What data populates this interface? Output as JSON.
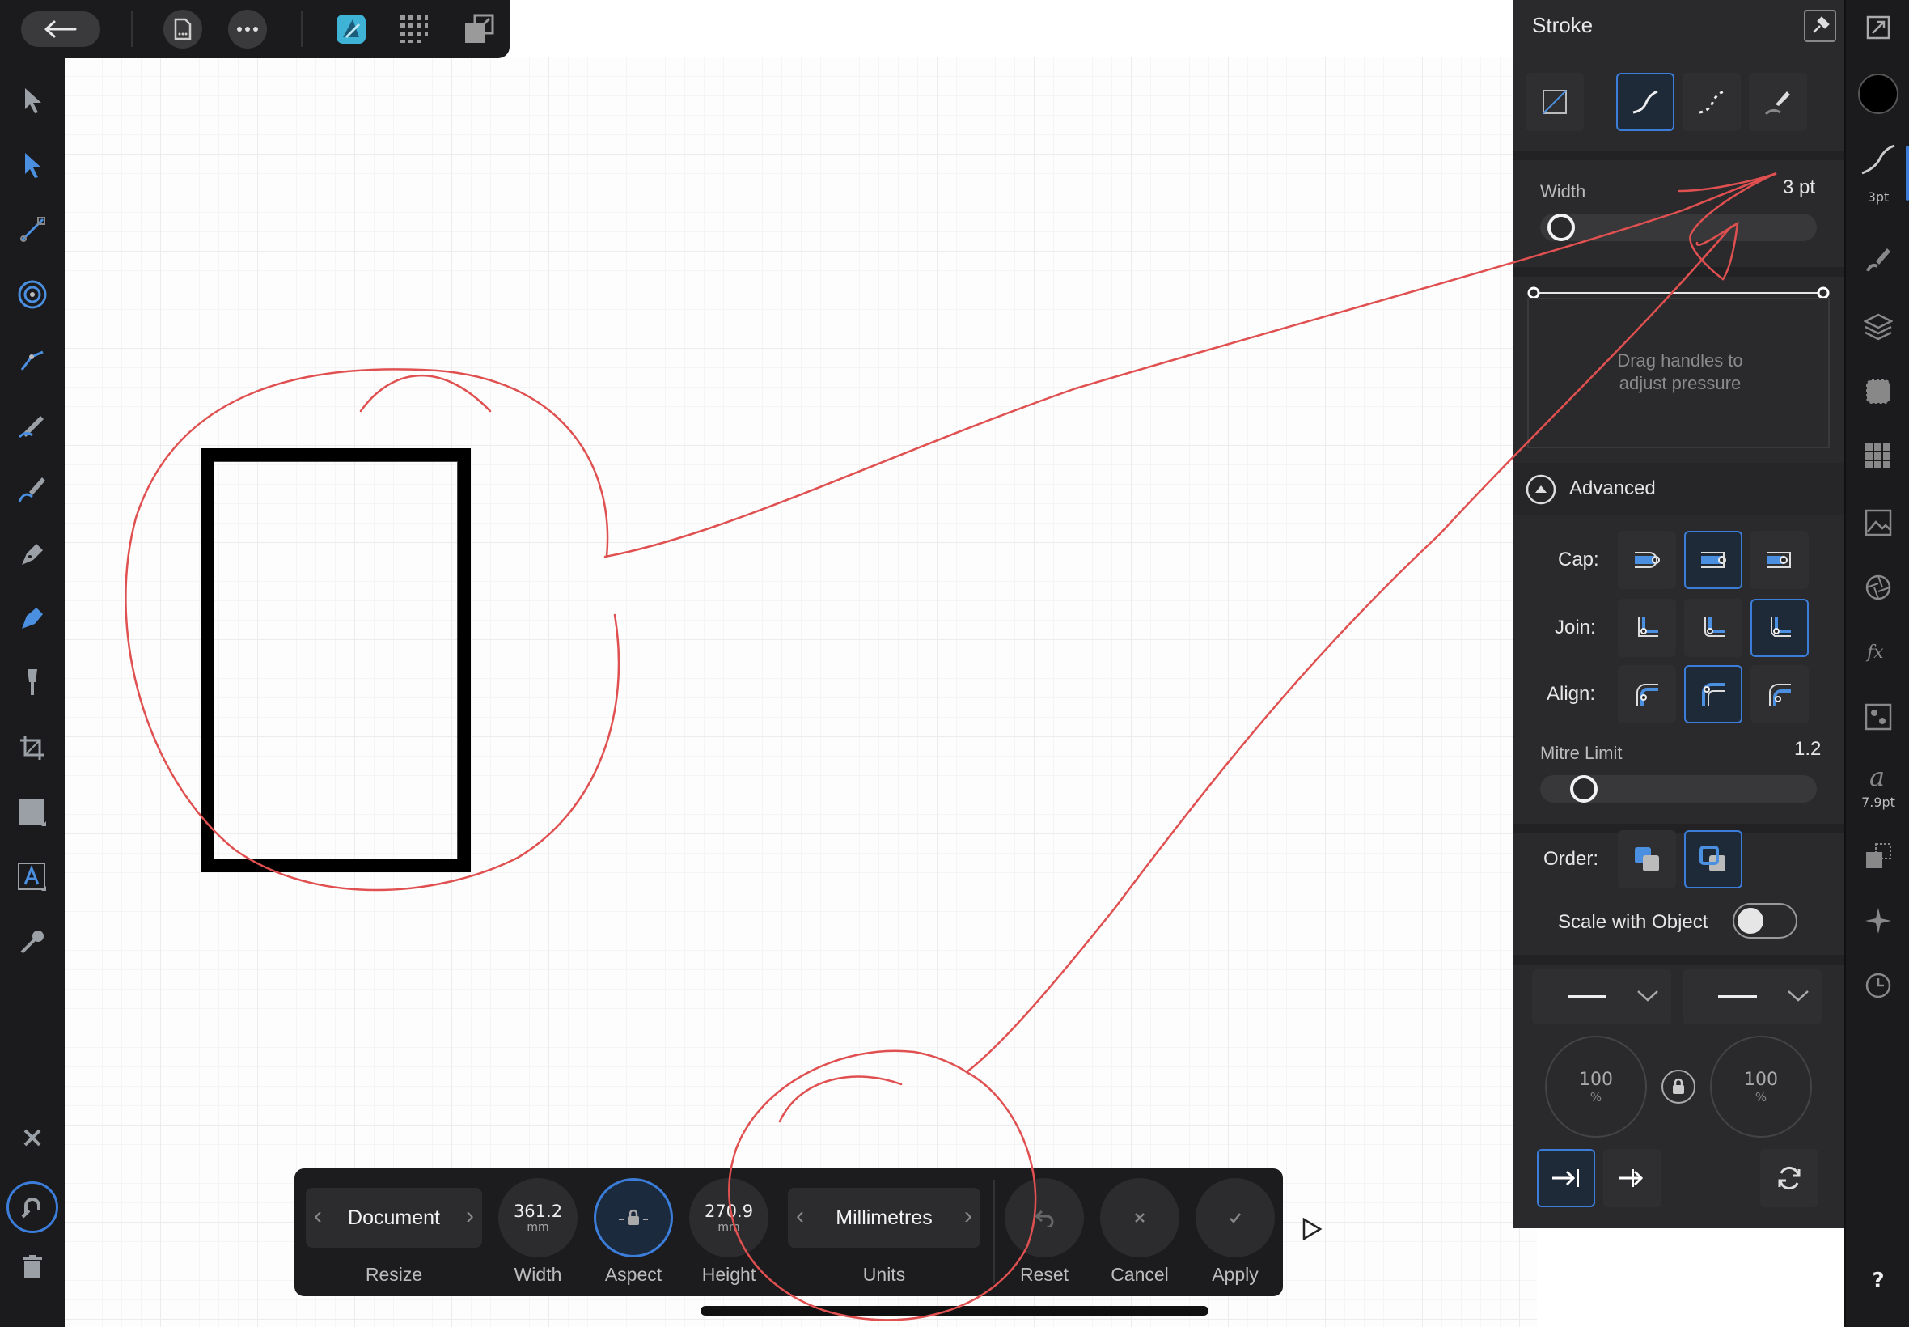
{
  "panel": {
    "title": "Stroke",
    "width_label": "Width",
    "width_value": "3 pt",
    "width_fraction": 0.03,
    "pressure_hint_line1": "Drag handles to",
    "pressure_hint_line2": "adjust pressure",
    "advanced_label": "Advanced",
    "cap_label": "Cap:",
    "join_label": "Join:",
    "align_label": "Align:",
    "mitre_label": "Mitre Limit",
    "mitre_value": "1.2",
    "mitre_fraction": 0.12,
    "order_label": "Order:",
    "scale_label": "Scale with Object",
    "scale_enabled": false,
    "start_scale": "100",
    "end_scale": "100",
    "percent_unit": "%"
  },
  "rightstrip": {
    "brush_size": "3pt",
    "font_size": "7.9pt",
    "help": "?"
  },
  "resizebar": {
    "mode": "Document",
    "mode_label": "Resize",
    "width_value": "361.2",
    "width_unit": "mm",
    "width_label": "Width",
    "aspect_label": "Aspect",
    "height_value": "270.9",
    "height_unit": "mm",
    "height_label": "Height",
    "units_value": "Millimetres",
    "units_label": "Units",
    "reset_label": "Reset",
    "cancel_label": "Cancel",
    "apply_label": "Apply"
  },
  "colors": {
    "accent": "#3b7dd8",
    "annotation": "#e05050",
    "toolbar_bg": "#1b1b1d",
    "panel_bg": "#2a2a2c"
  }
}
